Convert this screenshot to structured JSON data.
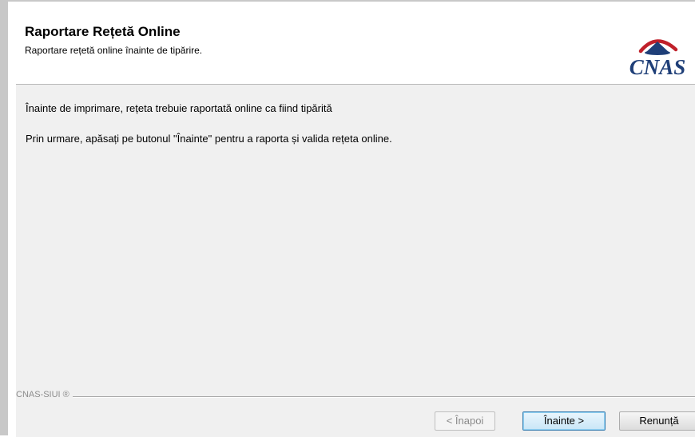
{
  "header": {
    "title": "Raportare Rețetă Online",
    "subtitle": "Raportare rețetă online înainte de tipărire.",
    "logo_text": "CNAS"
  },
  "content": {
    "message_1": "Înainte de imprimare, rețeta trebuie raportată online ca fiind tipărită",
    "message_2": "Prin urmare, apăsați pe butonul \"Înainte\" pentru a raporta și valida rețeta online."
  },
  "footer": {
    "brand_label": "CNAS-SIUI ®"
  },
  "buttons": {
    "back_label": "< Înapoi",
    "next_label": "Înainte >",
    "cancel_label": "Renunță"
  },
  "colors": {
    "logo_blue": "#1f3f78",
    "logo_red": "#c0202a",
    "panel_background": "#f0f0f0",
    "primary_button_border": "#3c7fb1"
  },
  "icons": {
    "logo": "cnas-logo-icon"
  }
}
